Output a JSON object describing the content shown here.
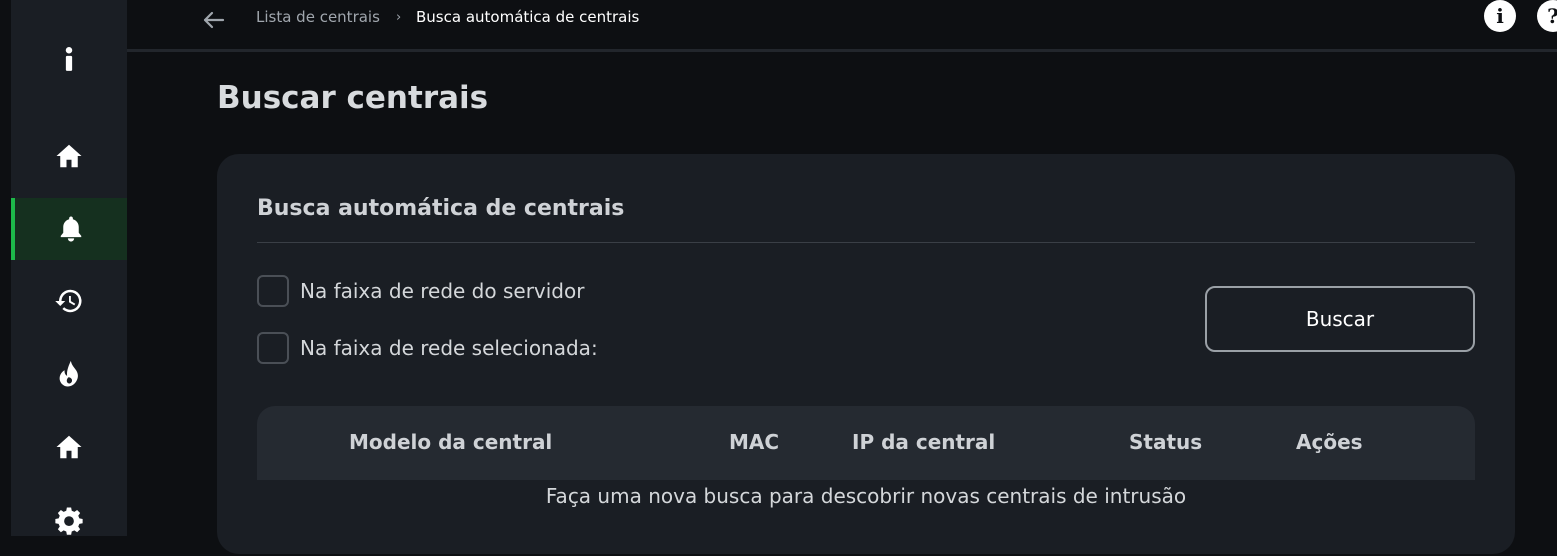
{
  "breadcrumb": {
    "items": [
      "Lista de centrais",
      "Busca automática de centrais"
    ],
    "separator": "›"
  },
  "top_icons": {
    "info": "i",
    "help": "?"
  },
  "sidebar": {
    "items": [
      {
        "name": "info-icon"
      },
      {
        "name": "home-icon"
      },
      {
        "name": "bell-icon",
        "active": true
      },
      {
        "name": "history-icon"
      },
      {
        "name": "flame-icon"
      },
      {
        "name": "home-icon"
      },
      {
        "name": "gear-icon"
      }
    ],
    "active_color": "#1db94a"
  },
  "page": {
    "title": "Buscar centrais"
  },
  "card": {
    "title": "Busca automática de centrais",
    "options": [
      {
        "label": "Na faixa de rede do servidor",
        "checked": false
      },
      {
        "label": "Na faixa de rede selecionada:",
        "checked": false
      }
    ],
    "search_button": "Buscar"
  },
  "table": {
    "columns": [
      "Modelo da central",
      "MAC",
      "IP da central",
      "Status",
      "Ações"
    ],
    "empty_message": "Faça uma nova busca para descobrir novas centrais de intrusão"
  }
}
